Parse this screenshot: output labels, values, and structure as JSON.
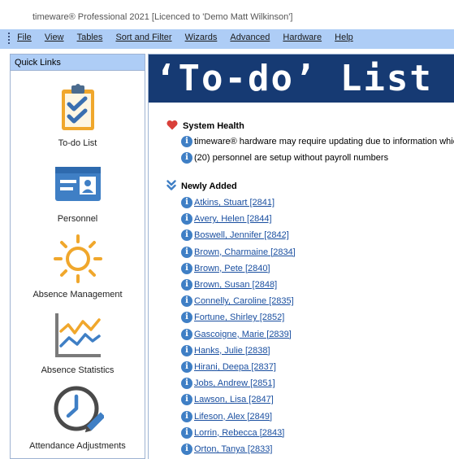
{
  "window": {
    "title": "timeware® Professional 2021 [Licenced to 'Demo Matt Wilkinson']"
  },
  "menu": [
    "File",
    "View",
    "Tables",
    "Sort and Filter",
    "Wizards",
    "Advanced",
    "Hardware",
    "Help"
  ],
  "quick_links": {
    "header": "Quick Links",
    "items": [
      {
        "label": "To-do List",
        "icon": "clipboard-check-icon"
      },
      {
        "label": "Personnel",
        "icon": "id-card-icon"
      },
      {
        "label": "Absence Management",
        "icon": "sun-icon"
      },
      {
        "label": "Absence Statistics",
        "icon": "line-chart-icon"
      },
      {
        "label": "Attendance Adjustments",
        "icon": "clock-pencil-icon"
      }
    ]
  },
  "main": {
    "title": "‘To-do’ List",
    "system_health": {
      "heading": "System Health",
      "messages": [
        "timeware® hardware may require updating due to information which",
        "(20) personnel are setup without payroll numbers"
      ]
    },
    "newly_added": {
      "heading": "Newly Added",
      "people": [
        "Atkins, Stuart [2841]",
        "Avery, Helen [2844]",
        "Boswell, Jennifer [2842]",
        "Brown, Charmaine [2834]",
        "Brown, Pete [2840]",
        "Brown, Susan [2848]",
        "Connelly, Caroline [2835]",
        "Fortune, Shirley [2852]",
        "Gascoigne, Marie [2839]",
        "Hanks, Julie [2838]",
        "Hirani, Deepa [2837]",
        "Jobs, Andrew [2851]",
        "Lawson, Lisa [2847]",
        "Lifeson, Alex [2849]",
        "Lorrin, Rebecca [2843]",
        "Orton, Tanya [2833]"
      ]
    }
  },
  "colors": {
    "banner": "#163a73",
    "menubar": "#aecdf6",
    "link": "#1a4fa0",
    "heart": "#d9403a",
    "info": "#3f7fc5"
  }
}
